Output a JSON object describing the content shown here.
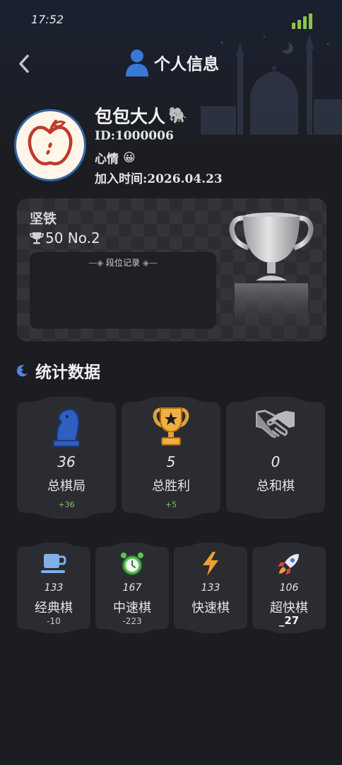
{
  "status_bar": {
    "time": "17:52",
    "signal_icon": "signal-bars-icon"
  },
  "header": {
    "title": "个人信息",
    "back_icon": "chevron-left-icon",
    "title_icon": "user-icon"
  },
  "profile": {
    "name": "包包大人",
    "name_emoji": "🐘",
    "id": "ID:1000006",
    "mood_label": "心情",
    "mood_emoji": "😀",
    "join_time": "加入时间:2026.04.23",
    "avatar_icon": "apple-avatar-icon"
  },
  "rank": {
    "tier": "坚铁",
    "score": "50 No.2",
    "record_label": "段位记录",
    "trophy_icon": "silver-trophy-icon"
  },
  "stats_section": {
    "title": "统计数据",
    "icon": "moon-icon"
  },
  "stats": [
    {
      "icon": "chess-knight-icon",
      "value": "36",
      "label": "总棋局",
      "delta": "+36"
    },
    {
      "icon": "gold-trophy-icon",
      "value": "5",
      "label": "总胜利",
      "delta": "+5"
    },
    {
      "icon": "handshake-icon",
      "value": "0",
      "label": "总和棋",
      "delta": ""
    }
  ],
  "modes": [
    {
      "icon": "coffee-cup-icon",
      "value": "133",
      "label": "经典棋",
      "delta": "-10"
    },
    {
      "icon": "alarm-clock-icon",
      "value": "167",
      "label": "中速棋",
      "delta": "-223"
    },
    {
      "icon": "lightning-icon",
      "value": "133",
      "label": "快速棋",
      "delta": ""
    },
    {
      "icon": "rocket-icon",
      "value": "106",
      "label": "超快棋",
      "delta": "_27"
    }
  ],
  "colors": {
    "background": "#1c1d22",
    "card": "#2c2d33",
    "accent_blue": "#3a6fc4",
    "positive_green": "#7fc75a",
    "signal_green": "#8bc34a"
  }
}
